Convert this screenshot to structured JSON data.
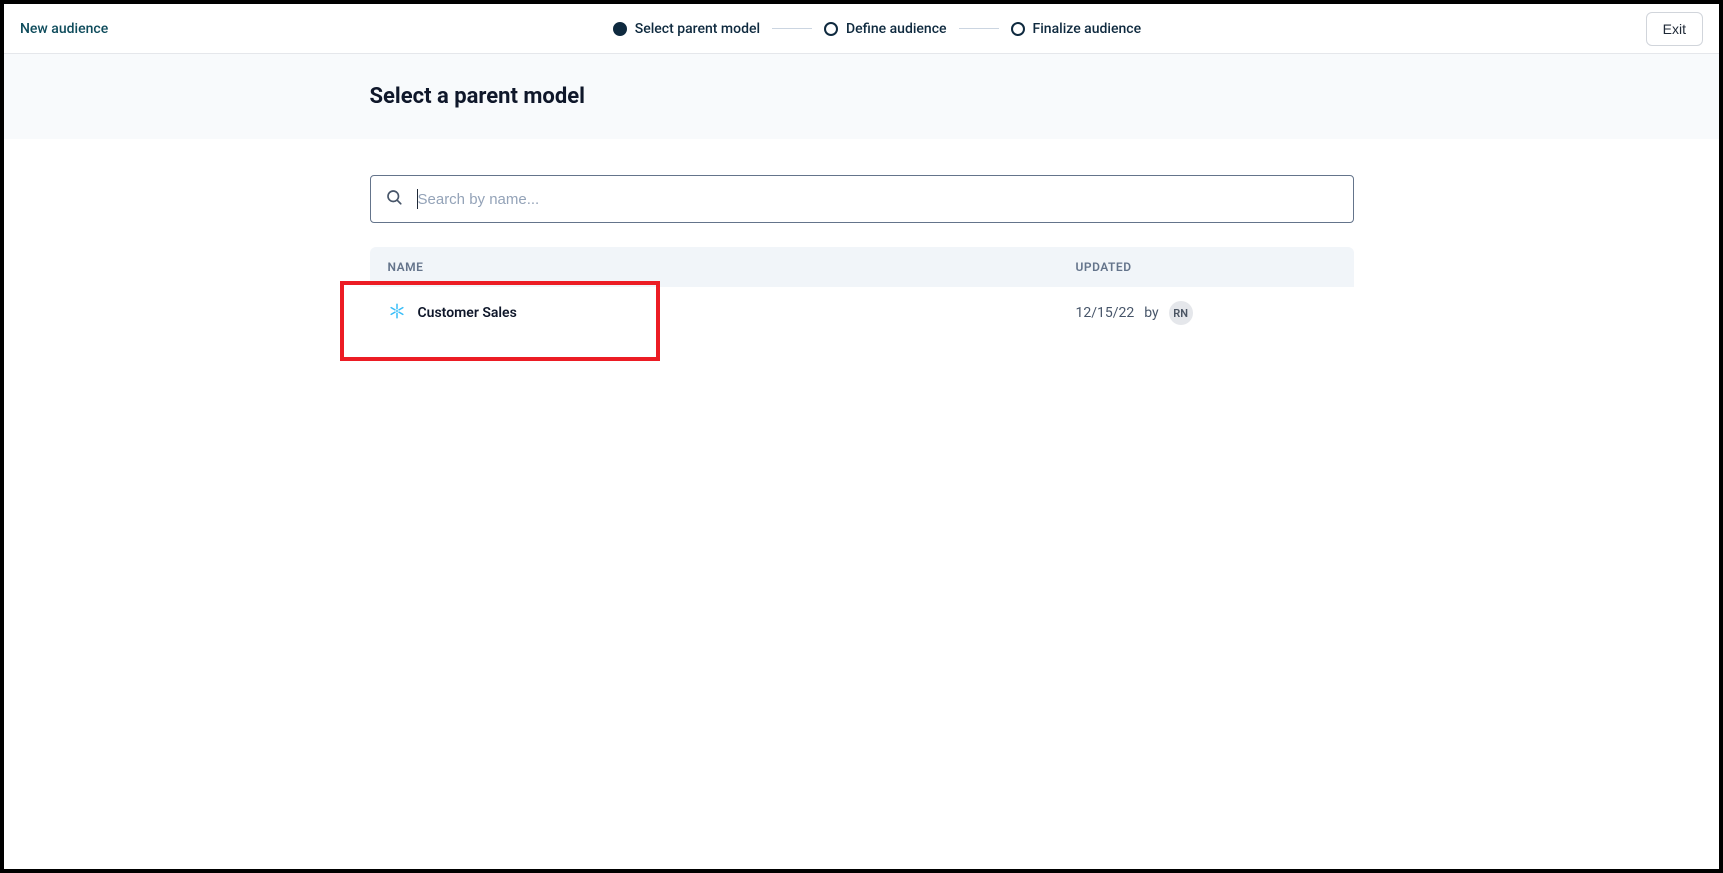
{
  "header": {
    "breadcrumb": "New audience",
    "exit_label": "Exit"
  },
  "stepper": {
    "step1": "Select parent model",
    "step2": "Define audience",
    "step3": "Finalize audience"
  },
  "page": {
    "title": "Select a parent model"
  },
  "search": {
    "placeholder": "Search by name..."
  },
  "table": {
    "columns": {
      "name": "NAME",
      "updated": "UPDATED"
    },
    "rows": [
      {
        "name": "Customer Sales",
        "updated_date": "12/15/22",
        "updated_by_label": "by",
        "updated_by_initials": "RN"
      }
    ]
  }
}
